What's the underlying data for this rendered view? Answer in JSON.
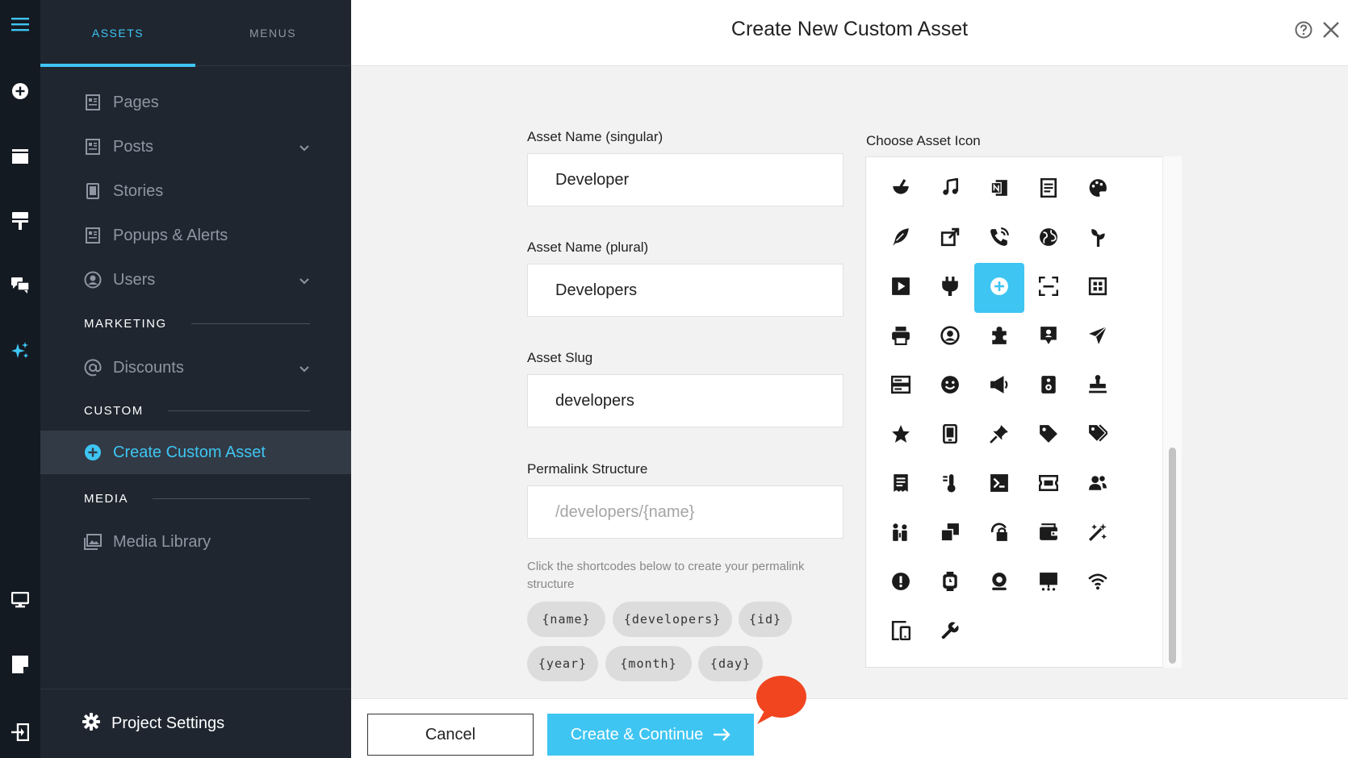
{
  "rail": {
    "icons": [
      "menu-icon",
      "add-circle-icon",
      "window-icon",
      "paint-roller-icon",
      "chat-icon",
      "sparkle-icon",
      "monitor-icon",
      "note-icon",
      "exit-icon"
    ]
  },
  "sidebar": {
    "tabs": [
      {
        "label": "ASSETS",
        "active": true
      },
      {
        "label": "MENUS",
        "active": false
      }
    ],
    "items": [
      {
        "label": "Pages",
        "icon": "page-icon"
      },
      {
        "label": "Posts",
        "icon": "page-icon",
        "expandable": true
      },
      {
        "label": "Stories",
        "icon": "mobile-page-icon"
      },
      {
        "label": "Popups & Alerts",
        "icon": "page-icon"
      },
      {
        "label": "Users",
        "icon": "user-circle-icon",
        "expandable": true
      }
    ],
    "sections": {
      "marketing": "MARKETING",
      "custom": "CUSTOM",
      "media": "MEDIA"
    },
    "discounts": "Discounts",
    "create_custom_asset": "Create Custom Asset",
    "media_library": "Media Library",
    "project_settings": "Project Settings"
  },
  "header": {
    "title": "Create New Custom Asset"
  },
  "form": {
    "singular_label": "Asset Name (singular)",
    "singular_value": "Developer",
    "plural_label": "Asset Name (plural)",
    "plural_value": "Developers",
    "slug_label": "Asset Slug",
    "slug_value": "developers",
    "permalink_label": "Permalink Structure",
    "permalink_placeholder": "/developers/{name}",
    "hint": "Click the shortcodes below to create your permalink structure",
    "shortcodes": [
      "{name}",
      "{developers}",
      "{id}",
      "{year}",
      "{month}",
      "{day}"
    ]
  },
  "icon_picker": {
    "label": "Choose Asset Icon",
    "selected_index": 12,
    "icons": [
      "mortar-pestle-icon",
      "music-note-icon",
      "onenote-icon",
      "document-icon",
      "palette-icon",
      "feather-pen-icon",
      "external-link-icon",
      "phone-call-icon",
      "globe-icon",
      "plant-icon",
      "play-square-icon",
      "plug-icon",
      "add-circle-icon",
      "scan-icon",
      "grid-icon",
      "printer-icon",
      "user-circle-icon",
      "puzzle-icon",
      "map-pin-icon",
      "paper-plane-icon",
      "server-icon",
      "smile-icon",
      "megaphone-icon",
      "speaker-icon",
      "stamp-icon",
      "star-icon",
      "tablet-icon",
      "pushpin-icon",
      "tag-icon",
      "tags-icon",
      "receipt-icon",
      "thermometer-icon",
      "terminal-icon",
      "ticket-icon",
      "users-icon",
      "people-icon",
      "copy-icon",
      "lock-rotate-icon",
      "wallet-icon",
      "magic-wand-icon",
      "alert-icon",
      "watch-icon",
      "webcam-icon",
      "presentation-icon",
      "wifi-icon",
      "devices-icon",
      "wrench-icon"
    ]
  },
  "footer": {
    "cancel": "Cancel",
    "primary": "Create & Continue"
  },
  "colors": {
    "accent": "#3ec5f2",
    "sidebar_bg": "#1f2630",
    "rail_bg": "#141a22",
    "chat_bubble": "#f0451f"
  }
}
